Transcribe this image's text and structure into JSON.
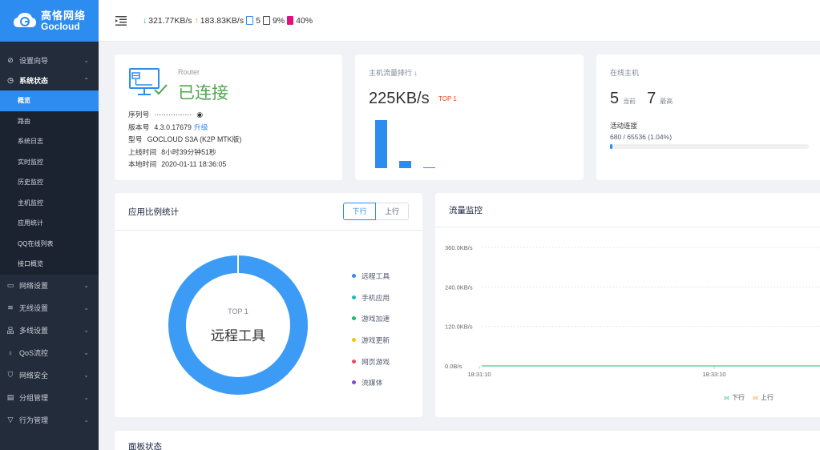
{
  "brand": {
    "name_cn": "高恪网络",
    "name_en": "Gocloud"
  },
  "topbar": {
    "download": "321.77KB/s",
    "upload": "183.83KB/s",
    "devices": "5",
    "cpu": "9%",
    "memory": "40%"
  },
  "sidebar": {
    "items": [
      {
        "label": "设置向导",
        "icon": "compass-icon"
      },
      {
        "label": "系统状态",
        "icon": "clock-icon"
      },
      {
        "label": "网络设置",
        "icon": "monitor-icon"
      },
      {
        "label": "无线设置",
        "icon": "wifi-icon"
      },
      {
        "label": "多线设置",
        "icon": "network-icon"
      },
      {
        "label": "QoS流控",
        "icon": "pin-icon"
      },
      {
        "label": "网络安全",
        "icon": "shield-icon"
      },
      {
        "label": "分组管理",
        "icon": "list-icon"
      },
      {
        "label": "行为管理",
        "icon": "filter-icon"
      }
    ],
    "sub_items": [
      "概览",
      "路由",
      "系统日志",
      "实时监控",
      "历史监控",
      "主机监控",
      "应用统计",
      "QQ在线列表",
      "接口概览"
    ]
  },
  "router_card": {
    "label": "Router",
    "status": "已连接",
    "serial_label": "序列号",
    "serial_value": "················",
    "version_label": "版本号",
    "version_value": "4.3.0.17679",
    "upgrade": "升级",
    "model_label": "型号",
    "model_value": "GOCLOUD S3A (K2P MTK版)",
    "uptime_label": "上线时间",
    "uptime_value": "8小时39分钟51秒",
    "localtime_label": "本地时间",
    "localtime_value": "2020-01-11 18:36:05"
  },
  "host_flow_card": {
    "title": "主机流量排行",
    "value": "225KB/s",
    "badge": "TOP 1",
    "bars": [
      1.0,
      0.15,
      0.02
    ]
  },
  "online_card": {
    "title": "在线主机",
    "current": "5",
    "current_label": "当前",
    "max": "7",
    "max_label": "最高",
    "active_label": "活动连接",
    "active_value": "680 / 65536 (1.04%)",
    "active_fraction": 0.0104
  },
  "app_card": {
    "title": "应用比例统计",
    "tabs": [
      "下行",
      "上行"
    ],
    "center_top": "TOP 1",
    "center_name": "远程工具",
    "legend": [
      {
        "label": "远程工具",
        "color": "#2d8cf0"
      },
      {
        "label": "手机应用",
        "color": "#19bebc"
      },
      {
        "label": "游戏加速",
        "color": "#19be6b"
      },
      {
        "label": "游戏更新",
        "color": "#ffc107"
      },
      {
        "label": "网页游戏",
        "color": "#ed4a6a"
      },
      {
        "label": "流媒体",
        "color": "#7a4ed9"
      }
    ]
  },
  "flow_card": {
    "title": "流量监控",
    "legend_down": "下行",
    "legend_up": "上行"
  },
  "chart_data": {
    "type": "line",
    "title": "流量监控",
    "y_ticks": [
      "360.0KB/s",
      "240.0KB/s",
      "120.0KB/s",
      "0.0B/s"
    ],
    "x_ticks": [
      "18:31:10",
      "18:33:10"
    ],
    "ylim": [
      0,
      360
    ],
    "series": [
      {
        "name": "下行",
        "color": "#19be6b",
        "x": [
          "18:31:10",
          "18:33:10"
        ],
        "values": [
          0,
          0
        ]
      },
      {
        "name": "上行",
        "color": "#ff9900",
        "x": [
          "18:31:10",
          "18:33:10"
        ],
        "values": [
          0,
          0
        ]
      }
    ],
    "grid": true,
    "legend": "bottom-right"
  },
  "panel_card": {
    "title": "面板状态"
  }
}
